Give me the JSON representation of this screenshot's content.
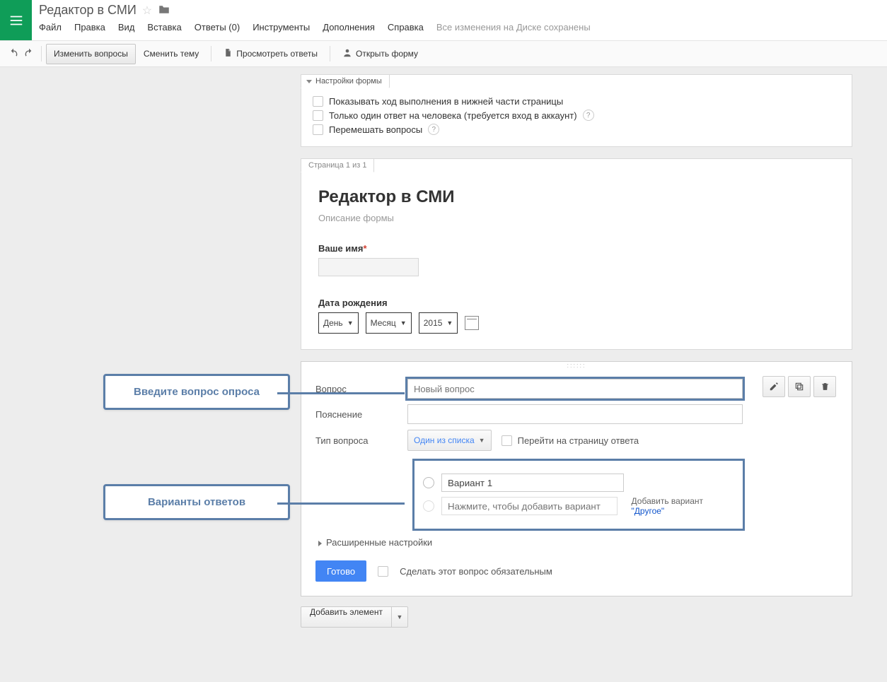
{
  "header": {
    "title": "Редактор в СМИ",
    "menus": [
      "Файл",
      "Правка",
      "Вид",
      "Вставка",
      "Ответы (0)",
      "Инструменты",
      "Дополнения",
      "Справка"
    ],
    "save_status": "Все изменения на Диске сохранены"
  },
  "toolbar": {
    "edit_questions": "Изменить вопросы",
    "change_theme": "Сменить тему",
    "view_answers": "Просмотреть ответы",
    "open_form": "Открыть форму"
  },
  "settings": {
    "tab": "Настройки формы",
    "opt1": "Показывать ход выполнения в нижней части страницы",
    "opt2": "Только один ответ на человека (требуется вход в аккаунт)",
    "opt3": "Перемешать вопросы"
  },
  "page": {
    "tab": "Страница 1 из 1",
    "title": "Редактор в СМИ",
    "desc": "Описание формы",
    "name_label": "Ваше имя",
    "dob_label": "Дата рождения",
    "day": "День",
    "month": "Месяц",
    "year": "2015"
  },
  "editor": {
    "q_label": "Вопрос",
    "q_placeholder": "Новый вопрос",
    "help_label": "Пояснение",
    "type_label": "Тип вопроса",
    "type_value": "Один из списка",
    "goto": "Перейти на страницу ответа",
    "opt1": "Вариант 1",
    "opt_add_placeholder": "Нажмите, чтобы добавить вариант",
    "add_other_pre": "Добавить вариант ",
    "add_other_link": "\"Другое\"",
    "advanced": "Расширенные настройки",
    "done": "Готово",
    "required": "Сделать этот вопрос обязательным"
  },
  "add_element": "Добавить элемент",
  "callouts": {
    "q": "Введите вопрос опроса",
    "opts": "Варианты ответов"
  }
}
